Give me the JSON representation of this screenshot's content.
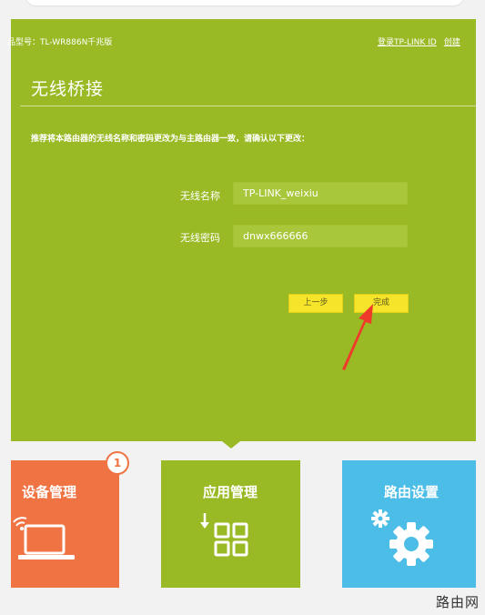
{
  "header": {
    "model_label": "型号：TL-WR886N千兆版",
    "model_display": "品型号：TL-WR886N千兆版",
    "login_link": "登录TP-LINK ID",
    "create_link": "创建"
  },
  "wizard": {
    "title": "无线桥接",
    "notice": "推荐将本路由器的无线名称和密码更改为与主路由器一致，请确认以下更改：",
    "fields": [
      {
        "label": "无线名称",
        "value": "TP-LINK_weixiu"
      },
      {
        "label": "无线密码",
        "value": "dnwx666666"
      }
    ],
    "prev_button": "上一步",
    "finish_button": "完成"
  },
  "tiles": [
    {
      "label": "设备管理",
      "badge": "1",
      "color": "#f07343"
    },
    {
      "label": "应用管理",
      "color": "#9aba25"
    },
    {
      "label": "路由设置",
      "color": "#4cbde6"
    }
  ],
  "annotation": {
    "arrow_color": "#ef3b2a"
  },
  "watermark": "路由网"
}
